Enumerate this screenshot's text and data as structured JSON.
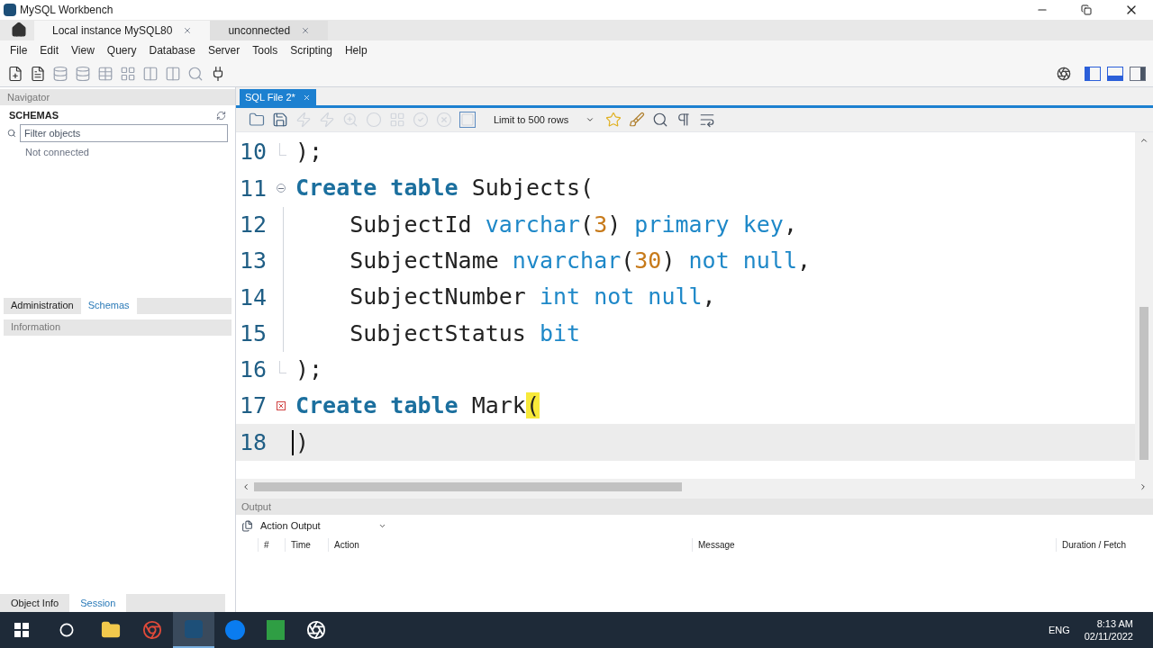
{
  "window": {
    "title": "MySQL Workbench"
  },
  "connection_tabs": [
    {
      "label": "Local instance MySQL80",
      "selected": true
    },
    {
      "label": "unconnected",
      "selected": false
    }
  ],
  "menu": [
    "File",
    "Edit",
    "View",
    "Query",
    "Database",
    "Server",
    "Tools",
    "Scripting",
    "Help"
  ],
  "navigator": {
    "header": "Navigator",
    "schemas_title": "SCHEMAS",
    "filter_placeholder": "Filter objects",
    "status": "Not connected"
  },
  "sidebar_tabs": [
    {
      "label": "Administration",
      "selected": false
    },
    {
      "label": "Schemas",
      "selected": true
    }
  ],
  "information": {
    "header": "Information"
  },
  "bottom_tabs": [
    {
      "label": "Object Info",
      "selected": false
    },
    {
      "label": "Session",
      "selected": true
    }
  ],
  "editor": {
    "tab": "SQL File 2*",
    "limit": "Limit to 500 rows",
    "lines": [
      {
        "number": "10",
        "kind": "fold-end",
        "current": false,
        "tokens": [
          {
            "text": ");",
            "kind": "plain"
          }
        ]
      },
      {
        "number": "11",
        "kind": "fold-start",
        "current": false,
        "tokens": [
          {
            "text": "Create table",
            "kind": "kw"
          },
          {
            "text": " Subjects(",
            "kind": "plain"
          }
        ]
      },
      {
        "number": "12",
        "kind": "fold-line",
        "current": false,
        "tokens": [
          {
            "text": "    SubjectId ",
            "kind": "plain"
          },
          {
            "text": "varchar",
            "kind": "type"
          },
          {
            "text": "(",
            "kind": "plain"
          },
          {
            "text": "3",
            "kind": "num"
          },
          {
            "text": ") ",
            "kind": "plain"
          },
          {
            "text": "primary key",
            "kind": "type"
          },
          {
            "text": ",",
            "kind": "plain"
          }
        ]
      },
      {
        "number": "13",
        "kind": "fold-line",
        "current": false,
        "tokens": [
          {
            "text": "    SubjectName ",
            "kind": "plain"
          },
          {
            "text": "nvarchar",
            "kind": "type"
          },
          {
            "text": "(",
            "kind": "plain"
          },
          {
            "text": "30",
            "kind": "num"
          },
          {
            "text": ") ",
            "kind": "plain"
          },
          {
            "text": "not null",
            "kind": "type"
          },
          {
            "text": ",",
            "kind": "plain"
          }
        ]
      },
      {
        "number": "14",
        "kind": "fold-line",
        "current": false,
        "tokens": [
          {
            "text": "    SubjectNumber ",
            "kind": "plain"
          },
          {
            "text": "int not null",
            "kind": "type"
          },
          {
            "text": ",",
            "kind": "plain"
          }
        ]
      },
      {
        "number": "15",
        "kind": "fold-line",
        "current": false,
        "tokens": [
          {
            "text": "    SubjectStatus ",
            "kind": "plain"
          },
          {
            "text": "bit",
            "kind": "type"
          }
        ]
      },
      {
        "number": "16",
        "kind": "fold-end",
        "current": false,
        "tokens": [
          {
            "text": ");",
            "kind": "plain"
          }
        ]
      },
      {
        "number": "17",
        "kind": "error",
        "current": false,
        "tokens": [
          {
            "text": "Create table",
            "kind": "kw"
          },
          {
            "text": " Mark",
            "kind": "plain"
          },
          {
            "text": "(",
            "kind": "match"
          }
        ]
      },
      {
        "number": "18",
        "kind": "plain",
        "current": true,
        "tokens": [
          {
            "text": ")",
            "kind": "plain"
          }
        ]
      }
    ]
  },
  "output": {
    "header": "Output",
    "selector": "Action Output",
    "columns": [
      "#",
      "Time",
      "Action",
      "Message",
      "Duration / Fetch"
    ]
  },
  "tray": {
    "language": "ENG",
    "time": "8:13 AM",
    "date": "02/11/2022"
  }
}
